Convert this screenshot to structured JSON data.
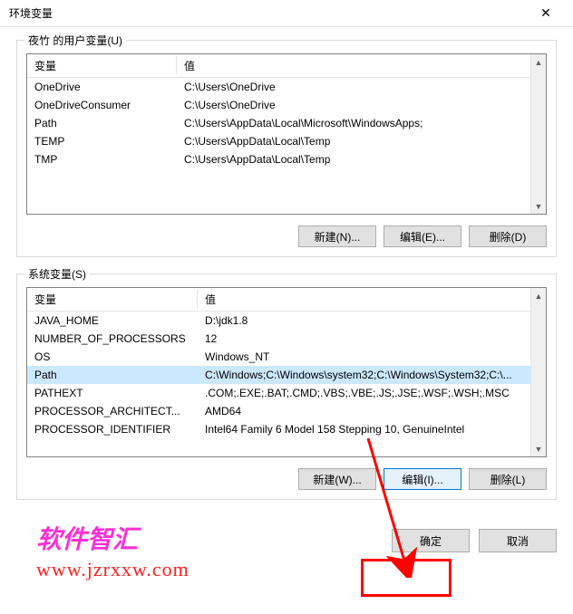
{
  "window": {
    "title": "环境变量",
    "close_glyph": "✕"
  },
  "user_section": {
    "label": "夜竹 的用户变量(U)",
    "headers": {
      "name": "变量",
      "value": "值"
    },
    "rows": [
      {
        "name": "OneDrive",
        "value": "C:\\Users\\OneDrive"
      },
      {
        "name": "OneDriveConsumer",
        "value": "C:\\Users\\OneDrive"
      },
      {
        "name": "Path",
        "value": "C:\\Users\\AppData\\Local\\Microsoft\\WindowsApps;"
      },
      {
        "name": "TEMP",
        "value": "C:\\Users\\AppData\\Local\\Temp"
      },
      {
        "name": "TMP",
        "value": "C:\\Users\\AppData\\Local\\Temp"
      }
    ],
    "buttons": {
      "new": "新建(N)...",
      "edit": "编辑(E)...",
      "delete": "删除(D)"
    }
  },
  "system_section": {
    "label": "系统变量(S)",
    "headers": {
      "name": "变量",
      "value": "值"
    },
    "rows": [
      {
        "name": "JAVA_HOME",
        "value": "D:\\jdk1.8"
      },
      {
        "name": "NUMBER_OF_PROCESSORS",
        "value": "12"
      },
      {
        "name": "OS",
        "value": "Windows_NT"
      },
      {
        "name": "Path",
        "value": "C:\\Windows;C:\\Windows\\system32;C:\\Windows\\System32;C:\\..."
      },
      {
        "name": "PATHEXT",
        "value": ".COM;.EXE;.BAT;.CMD;.VBS;.VBE;.JS;.JSE;.WSF;.WSH;.MSC"
      },
      {
        "name": "PROCESSOR_ARCHITECT...",
        "value": "AMD64"
      },
      {
        "name": "PROCESSOR_IDENTIFIER",
        "value": "Intel64 Family 6 Model 158 Stepping 10, GenuineIntel"
      }
    ],
    "selected_index": 3,
    "buttons": {
      "new": "新建(W)...",
      "edit": "编辑(I)...",
      "delete": "删除(L)"
    }
  },
  "footer": {
    "ok": "确定",
    "cancel": "取消"
  },
  "watermark": {
    "line1": "软件智汇",
    "line2": "www.jzrxxw.com"
  },
  "arrow_glyphs": {
    "up": "▲",
    "down": "▼"
  }
}
